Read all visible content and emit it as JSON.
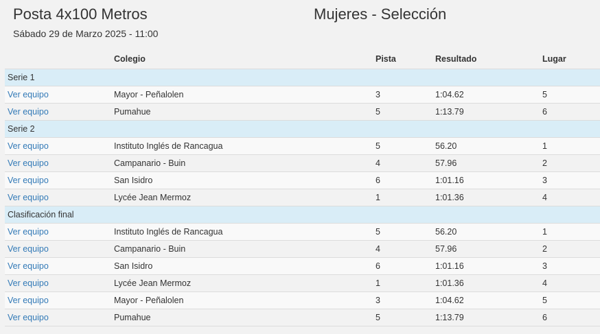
{
  "event": {
    "title": "Posta 4x100 Metros",
    "category": "Mujeres - Selección",
    "date": "Sábado 29 de Marzo 2025 - 11:00"
  },
  "table": {
    "headers": {
      "colegio": "Colegio",
      "pista": "Pista",
      "resultado": "Resultado",
      "lugar": "Lugar"
    },
    "link_label": "Ver equipo",
    "groups": [
      {
        "name": "Serie 1",
        "rows": [
          {
            "colegio": "Mayor - Peñalolen",
            "pista": "3",
            "resultado": "1:04.62",
            "lugar": "5"
          },
          {
            "colegio": "Pumahue",
            "pista": "5",
            "resultado": "1:13.79",
            "lugar": "6"
          }
        ]
      },
      {
        "name": "Serie 2",
        "rows": [
          {
            "colegio": "Instituto Inglés de Rancagua",
            "pista": "5",
            "resultado": "56.20",
            "lugar": "1"
          },
          {
            "colegio": "Campanario - Buin",
            "pista": "4",
            "resultado": "57.96",
            "lugar": "2"
          },
          {
            "colegio": "San Isidro",
            "pista": "6",
            "resultado": "1:01.16",
            "lugar": "3"
          },
          {
            "colegio": "Lycée Jean Mermoz",
            "pista": "1",
            "resultado": "1:01.36",
            "lugar": "4"
          }
        ]
      },
      {
        "name": "Clasificación final",
        "rows": [
          {
            "colegio": "Instituto Inglés de Rancagua",
            "pista": "5",
            "resultado": "56.20",
            "lugar": "1"
          },
          {
            "colegio": "Campanario - Buin",
            "pista": "4",
            "resultado": "57.96",
            "lugar": "2"
          },
          {
            "colegio": "San Isidro",
            "pista": "6",
            "resultado": "1:01.16",
            "lugar": "3"
          },
          {
            "colegio": "Lycée Jean Mermoz",
            "pista": "1",
            "resultado": "1:01.36",
            "lugar": "4"
          },
          {
            "colegio": "Mayor - Peñalolen",
            "pista": "3",
            "resultado": "1:04.62",
            "lugar": "5"
          },
          {
            "colegio": "Pumahue",
            "pista": "5",
            "resultado": "1:13.79",
            "lugar": "6"
          }
        ]
      }
    ]
  }
}
